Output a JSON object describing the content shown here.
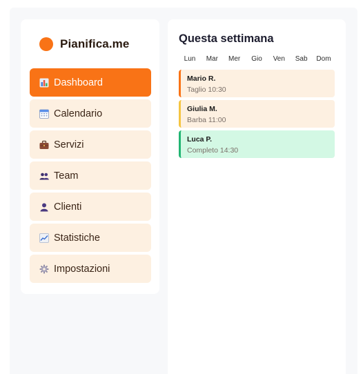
{
  "brand": {
    "name": "Pianifica.me",
    "color": "#f97316"
  },
  "sidebar": {
    "items": [
      {
        "label": "Dashboard",
        "icon": "bar-chart-icon",
        "active": true
      },
      {
        "label": "Calendario",
        "icon": "calendar-icon",
        "active": false
      },
      {
        "label": "Servizi",
        "icon": "briefcase-icon",
        "active": false
      },
      {
        "label": "Team",
        "icon": "people-icon",
        "active": false
      },
      {
        "label": "Clienti",
        "icon": "person-icon",
        "active": false
      },
      {
        "label": "Statistiche",
        "icon": "trend-chart-icon",
        "active": false
      },
      {
        "label": "Impostazioni",
        "icon": "gear-icon",
        "active": false
      }
    ]
  },
  "main": {
    "title": "Questa settimana",
    "days": [
      "Lun",
      "Mar",
      "Mer",
      "Gio",
      "Ven",
      "Sab",
      "Dom"
    ],
    "appointments": [
      {
        "name": "Mario R.",
        "detail": "Taglio 10:30",
        "accent": "#f97316",
        "background": "#fdf0e1"
      },
      {
        "name": "Giulia M.",
        "detail": "Barba 11:00",
        "accent": "#f5c542",
        "background": "#fdf0e1"
      },
      {
        "name": "Luca P.",
        "detail": "Completo 14:30",
        "accent": "#22b573",
        "background": "#d3f8e4"
      }
    ]
  }
}
